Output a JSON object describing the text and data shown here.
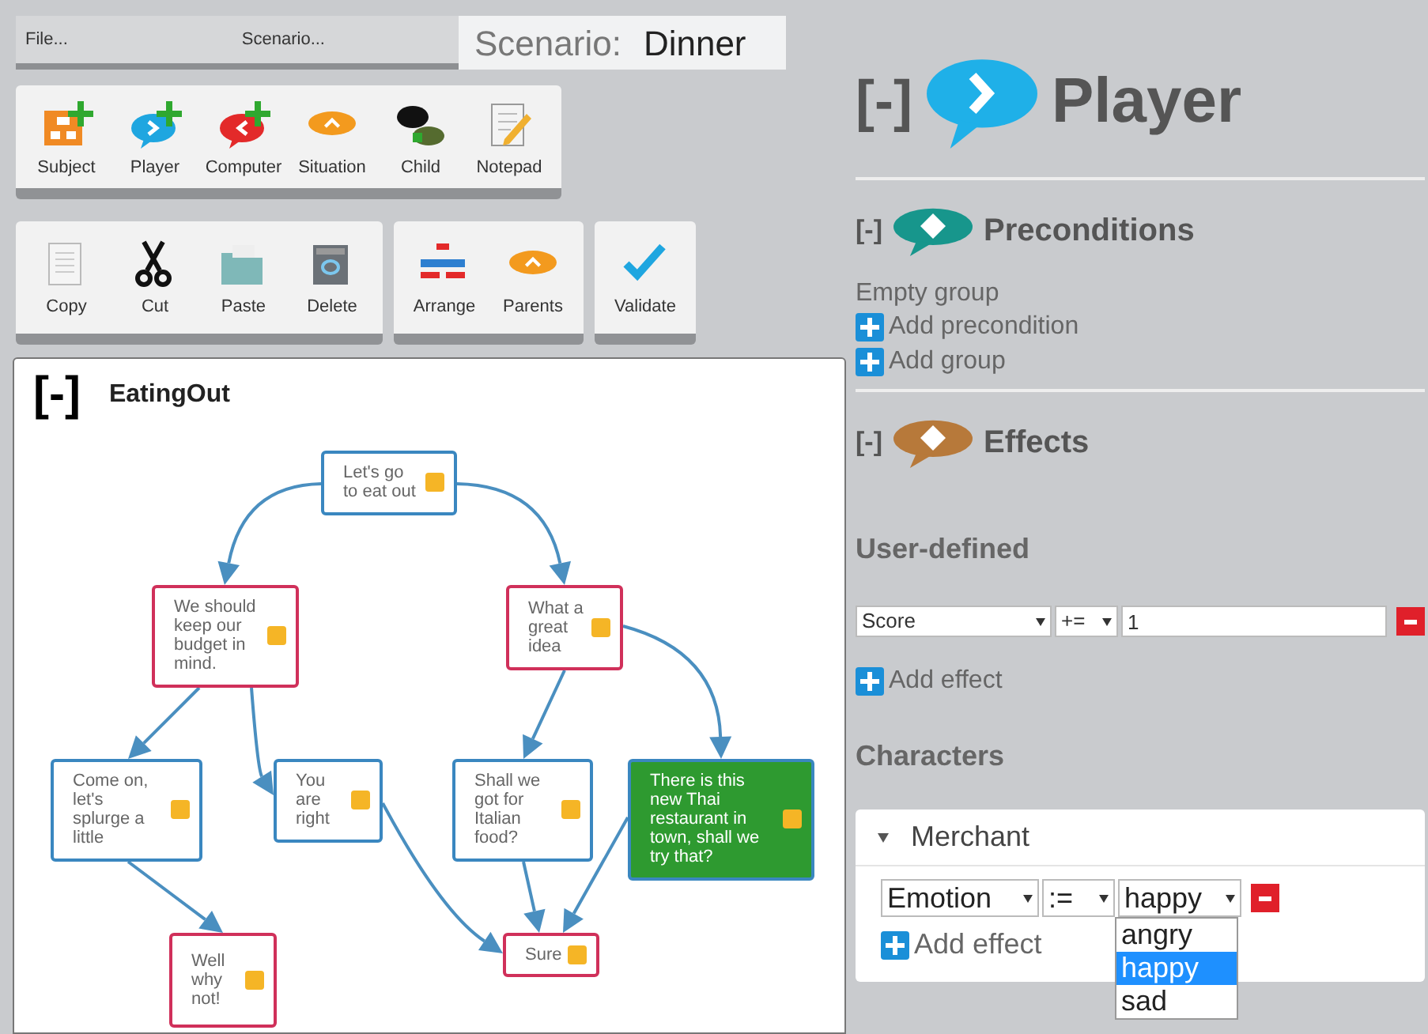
{
  "menu": [
    {
      "label": "File..."
    },
    {
      "label": "Scenario..."
    }
  ],
  "scenario": {
    "label": "Scenario:",
    "name": "Dinner"
  },
  "insert_toolbar": [
    {
      "kind": "subject",
      "label": "Subject"
    },
    {
      "kind": "player",
      "label": "Player"
    },
    {
      "kind": "computer",
      "label": "Computer"
    },
    {
      "kind": "situation",
      "label": "Situation"
    },
    {
      "kind": "child",
      "label": "Child"
    },
    {
      "kind": "notepad",
      "label": "Notepad"
    }
  ],
  "edit_toolbar": [
    {
      "items": [
        {
          "kind": "copy",
          "label": "Copy"
        },
        {
          "kind": "cut",
          "label": "Cut"
        },
        {
          "kind": "paste",
          "label": "Paste"
        },
        {
          "kind": "delete",
          "label": "Delete"
        }
      ]
    },
    {
      "items": [
        {
          "kind": "arrange",
          "label": "Arrange"
        },
        {
          "kind": "parents",
          "label": "Parents"
        }
      ]
    },
    {
      "items": [
        {
          "kind": "validate",
          "label": "Validate"
        }
      ]
    }
  ],
  "canvas": {
    "collapse": "[-]",
    "title": "EatingOut",
    "nodes": [
      {
        "kind": "player",
        "text": "Let's go to eat out",
        "selected": false
      },
      {
        "kind": "computer",
        "text": "We should keep our budget in mind.",
        "selected": false
      },
      {
        "kind": "computer",
        "text": "What a great idea",
        "selected": false
      },
      {
        "kind": "player",
        "text": "Come on, let's splurge a little",
        "selected": false
      },
      {
        "kind": "player",
        "text": "You are right",
        "selected": false
      },
      {
        "kind": "player",
        "text": "Shall we got for Italian food?",
        "selected": false
      },
      {
        "kind": "player",
        "text": "There is this new Thai restaurant in town, shall we try that?",
        "selected": true
      },
      {
        "kind": "computer",
        "text": "Well why not!",
        "selected": false
      },
      {
        "kind": "computer",
        "text": "Sure",
        "selected": false
      }
    ]
  },
  "panel": {
    "collapse": "[-]",
    "title": "Player",
    "preconditions": {
      "collapse": "[-]",
      "title": "Preconditions",
      "status": "Empty group",
      "actions": [
        "Add precondition",
        "Add group"
      ]
    },
    "effects": {
      "collapse": "[-]",
      "title": "Effects",
      "user_defined": {
        "heading": "User-defined",
        "rows": [
          {
            "parameter": "Score",
            "operator": "+=",
            "value": "1"
          }
        ],
        "add": "Add effect"
      },
      "characters": {
        "heading": "Characters",
        "items": [
          {
            "name": "Merchant",
            "expanded": true,
            "rows": [
              {
                "parameter": "Emotion",
                "operator": ":=",
                "value": "happy",
                "options": [
                  {
                    "label": "angry",
                    "selected": false
                  },
                  {
                    "label": "happy",
                    "selected": true
                  },
                  {
                    "label": "sad",
                    "selected": false
                  }
                ]
              }
            ],
            "add": "Add effect"
          }
        ]
      }
    }
  }
}
